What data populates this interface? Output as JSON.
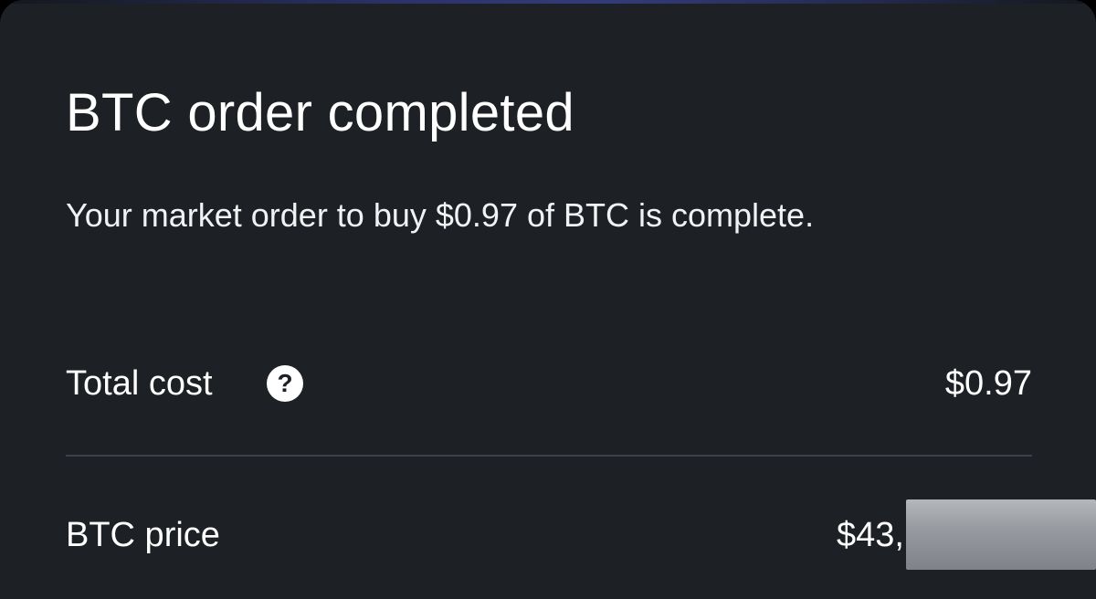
{
  "page": {
    "title": "BTC order completed",
    "subtitle": "Your market order to buy $0.97 of BTC is complete."
  },
  "rows": [
    {
      "label": "Total cost",
      "value": "$0.97",
      "icon": "question-circle-icon",
      "icon_glyph": "?"
    },
    {
      "label": "BTC price",
      "value": "$43,"
    }
  ],
  "colors": {
    "background": "#1d2125",
    "text": "#ffffff",
    "divider": "#3c4147",
    "redaction": "#9a9ea3"
  }
}
